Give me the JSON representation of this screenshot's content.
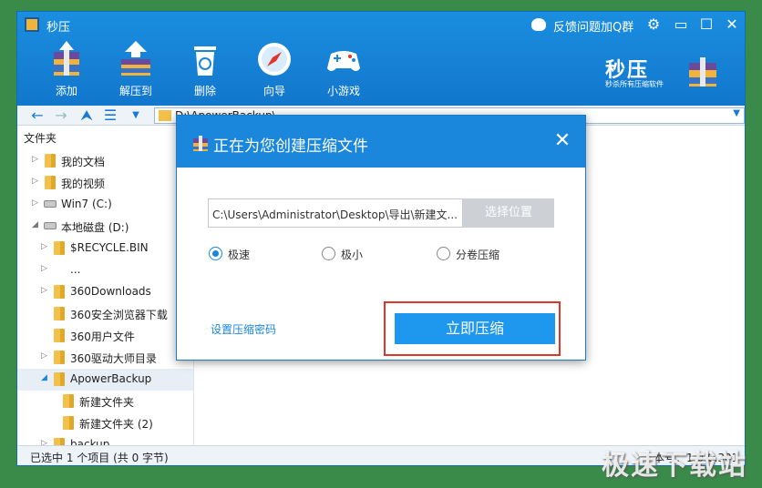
{
  "window": {
    "title": "秒压",
    "feedback": "反馈问题加Q群",
    "settings_glyph": "⚙",
    "minimize_glyph": "▭",
    "maximize_glyph": "☐",
    "close_glyph": "✕"
  },
  "toolbar": {
    "items": [
      {
        "label": "添加",
        "icon": "archive-add-icon"
      },
      {
        "label": "解压到",
        "icon": "extract-icon"
      },
      {
        "label": "删除",
        "icon": "trash-icon"
      },
      {
        "label": "向导",
        "icon": "compass-icon"
      },
      {
        "label": "小游戏",
        "icon": "gamepad-icon"
      }
    ]
  },
  "brand": {
    "name": "秒压",
    "tagline": "秒杀所有压缩软件"
  },
  "addressbar": {
    "back": "←",
    "forward": "→",
    "up": "⮝",
    "view": "☰",
    "view_dropdown": "▼",
    "path": "D:\\ApowerBackup\\",
    "dropdown": "▼"
  },
  "sidebar": {
    "header": "文件夹",
    "items": [
      {
        "label": "我的文档",
        "arrow": "▷",
        "type": "folder"
      },
      {
        "label": "我的视频",
        "arrow": "▷",
        "type": "folder"
      },
      {
        "label": "Win7 (C:)",
        "arrow": "▷",
        "type": "drive"
      },
      {
        "label": "本地磁盘 (D:)",
        "arrow": "◢",
        "type": "drive"
      },
      {
        "label": "$RECYCLE.BIN",
        "arrow": "▷",
        "type": "folder"
      },
      {
        "label": "...",
        "arrow": "▷",
        "type": "none"
      },
      {
        "label": "360Downloads",
        "arrow": "▷",
        "type": "folder"
      },
      {
        "label": "360安全浏览器下载",
        "arrow": "",
        "type": "folder"
      },
      {
        "label": "360用户文件",
        "arrow": "",
        "type": "folder"
      },
      {
        "label": "360驱动大师目录",
        "arrow": "▷",
        "type": "folder"
      },
      {
        "label": "ApowerBackup",
        "arrow": "◢",
        "type": "folder"
      },
      {
        "label": "新建文件夹",
        "arrow": "",
        "type": "folder"
      },
      {
        "label": "新建文件夹 (2)",
        "arrow": "",
        "type": "folder"
      },
      {
        "label": "backup",
        "arrow": "▷",
        "type": "folder"
      }
    ]
  },
  "status": {
    "selection": "已选中 1 个项目 (共 0 字节)",
    "right": "本号：1.0.0.301"
  },
  "watermark": "极速下载站",
  "dialog": {
    "title": "正在为您创建压缩文件",
    "close": "✕",
    "path_value": "C:\\Users\\Administrator\\Desktop\\导出\\新建文...",
    "choose_location": "选择位置",
    "modes": [
      {
        "label": "极速",
        "selected": true
      },
      {
        "label": "极小",
        "selected": false
      },
      {
        "label": "分卷压缩",
        "selected": false
      }
    ],
    "set_password": "设置压缩密码",
    "compress_now": "立即压缩"
  }
}
